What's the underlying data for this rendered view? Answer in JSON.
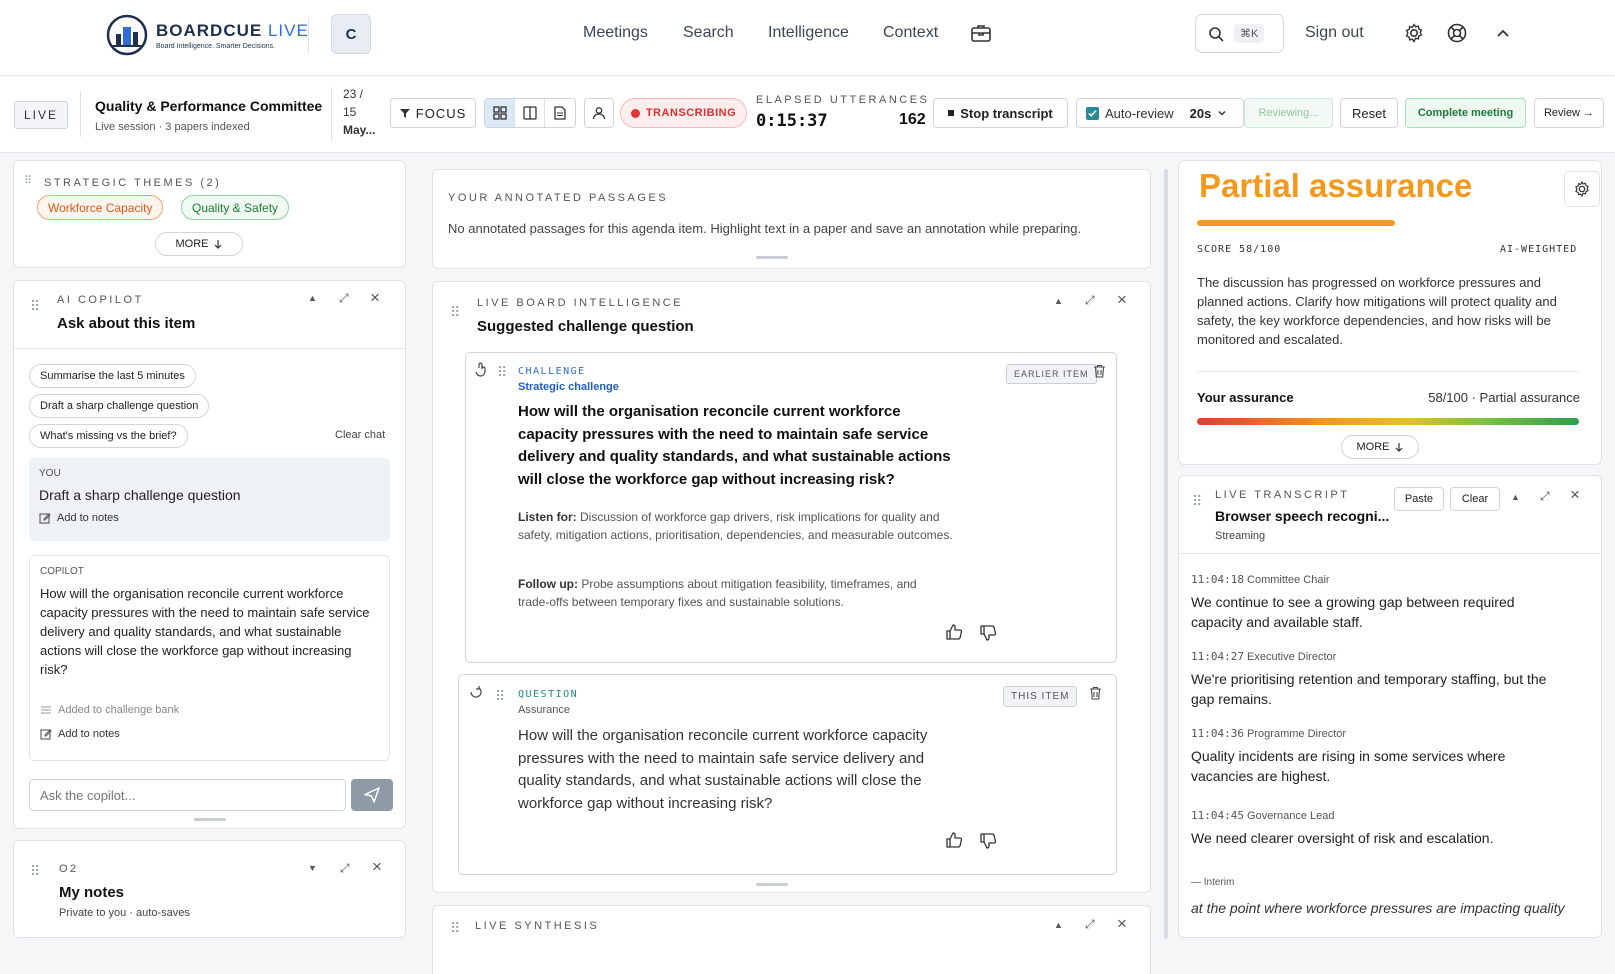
{
  "brand": {
    "name": "BOARDCUE",
    "name_suffix": "LIVE",
    "tagline": "Board Intelligence. Smarter Decisions."
  },
  "org_initial": "C",
  "nav": {
    "items": [
      "Meetings",
      "Search",
      "Intelligence",
      "Context"
    ],
    "briefcase_icon": "briefcase-icon"
  },
  "search": {
    "shortcut": "⌘K"
  },
  "signout": "Sign out",
  "session": {
    "live_label": "LIVE",
    "title": "Quality & Performance Committee",
    "subtitle": "Live session · 3 papers indexed",
    "date_line1": "23 /",
    "date_line2": "15",
    "date_line3": "May...",
    "focus_label": "FOCUS",
    "transcribing_label": "TRANSCRIBING",
    "elapsed_label": "ELAPSED",
    "utterances_label": "UTTERANCES",
    "elapsed_value": "0:15:37",
    "utterances_value": "162",
    "stop_label": "Stop transcript",
    "autoreview_label": "Auto-review",
    "autoreview_interval": "20s",
    "reviewing_label": "Reviewing...",
    "reset_label": "Reset",
    "complete_label": "Complete meeting",
    "review_label": "Review →"
  },
  "themes": {
    "label": "STRATEGIC THEMES (2)",
    "items": [
      "Workforce Capacity",
      "Quality & Safety"
    ],
    "more": "MORE"
  },
  "copilot": {
    "eyebrow": "AI COPILOT",
    "title": "Ask about this item",
    "suggestions": [
      "Summarise the last 5 minutes",
      "Draft a sharp challenge question",
      "What's missing vs the brief?"
    ],
    "clear": "Clear chat",
    "user_label": "YOU",
    "user_message": "Draft a sharp challenge question",
    "add_notes": "Add to notes",
    "copilot_label": "COPILOT",
    "copilot_message": "How will the organisation reconcile current workforce capacity pressures with the need to maintain safe service delivery and quality standards, and what sustainable actions will close the workforce gap without increasing risk?",
    "added_bank": "Added to challenge bank",
    "input_placeholder": "Ask the copilot..."
  },
  "notes": {
    "eyebrow": "O2",
    "title": "My notes",
    "subtitle": "Private to you · auto-saves"
  },
  "annotated": {
    "eyebrow": "YOUR ANNOTATED PASSAGES",
    "text": "No annotated passages for this agenda item. Highlight text in a paper and save an annotation while preparing."
  },
  "intel": {
    "eyebrow": "LIVE BOARD INTELLIGENCE",
    "title": "Suggested challenge question",
    "card1": {
      "kind": "CHALLENGE",
      "subkind": "Strategic challenge",
      "badge": "EARLIER ITEM",
      "question": "How will the organisation reconcile current workforce capacity pressures with the need to maintain safe service delivery and quality standards, and what sustainable actions will close the workforce gap without increasing risk?",
      "listen_label": "Listen for:",
      "listen_text": "Discussion of workforce gap drivers, risk implications for quality and safety, mitigation actions, prioritisation, dependencies, and measurable outcomes.",
      "follow_label": "Follow up:",
      "follow_text": "Probe assumptions about mitigation feasibility, timeframes, and trade-offs between temporary fixes and sustainable solutions."
    },
    "card2": {
      "kind": "QUESTION",
      "subkind": "Assurance",
      "badge": "THIS ITEM",
      "question": "How will the organisation reconcile current workforce capacity pressures with the need to maintain safe service delivery and quality standards, and what sustainable actions will close the workforce gap without increasing risk?"
    }
  },
  "synthesis": {
    "eyebrow": "LIVE SYNTHESIS"
  },
  "assurance": {
    "headline": "Partial assurance",
    "score_label": "SCORE 58/100",
    "weighting": "AI-WEIGHTED",
    "score": 58,
    "summary": "The discussion has progressed on workforce pressures and planned actions. Clarify how mitigations will protect quality and safety, the key workforce dependencies, and how risks will be monitored and escalated.",
    "your_label": "Your assurance",
    "your_value": "58/100 · Partial assurance",
    "more": "MORE",
    "accent": "#f39a1e"
  },
  "transcript": {
    "eyebrow": "LIVE TRANSCRIPT",
    "title": "Browser speech recogni...",
    "status": "Streaming",
    "paste": "Paste",
    "clear": "Clear",
    "entries": [
      {
        "time": "11:04:18",
        "speaker": "Committee Chair",
        "text": "We continue to see a growing gap between required capacity and available staff."
      },
      {
        "time": "11:04:27",
        "speaker": "Executive Director",
        "text": "We're prioritising retention and temporary staffing, but the gap remains."
      },
      {
        "time": "11:04:36",
        "speaker": "Programme Director",
        "text": "Quality incidents are rising in some services where vacancies are highest."
      },
      {
        "time": "11:04:45",
        "speaker": "Governance Lead",
        "text": "We need clearer oversight of risk and escalation."
      }
    ],
    "interim_label": "Interim",
    "interim_text": "at the point where workforce pressures are impacting quality"
  }
}
